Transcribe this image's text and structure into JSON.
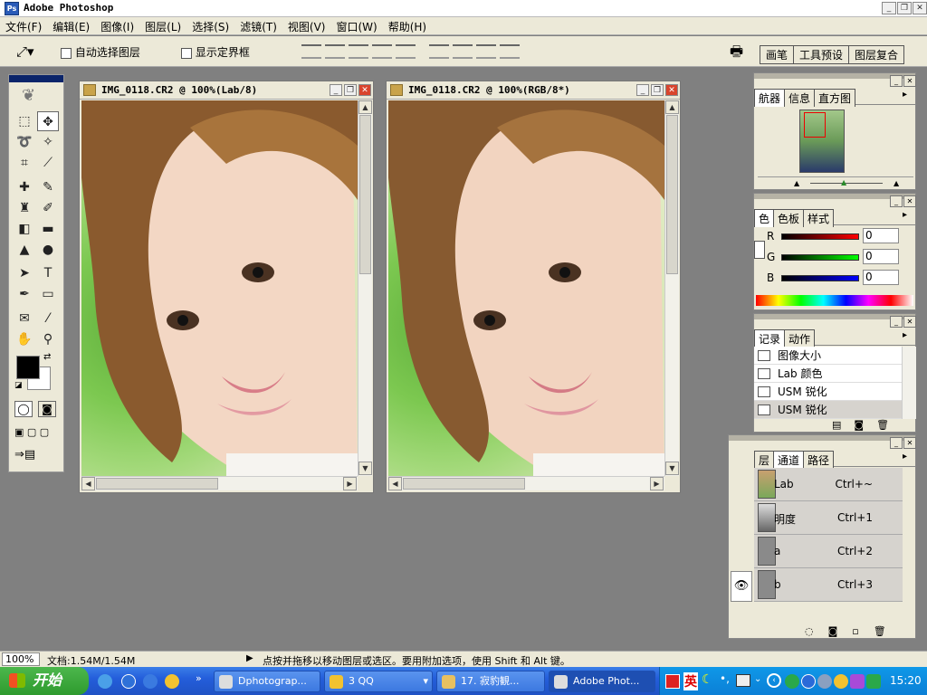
{
  "app": {
    "title": "Adobe Photoshop"
  },
  "menu": [
    "文件(F)",
    "编辑(E)",
    "图像(I)",
    "图层(L)",
    "选择(S)",
    "滤镜(T)",
    "视图(V)",
    "窗口(W)",
    "帮助(H)"
  ],
  "options": {
    "auto_select": "自动选择图层",
    "show_bounds": "显示定界框",
    "tabs": [
      "画笔",
      "工具预设",
      "图层复合"
    ]
  },
  "doc1": {
    "title": "IMG_0118.CR2 @ 100%(Lab/8)"
  },
  "doc2": {
    "title": "IMG_0118.CR2 @ 100%(RGB/8*)"
  },
  "navigator": {
    "tabs": [
      "航器",
      "信息",
      "直方图"
    ]
  },
  "color": {
    "tabs": [
      "色",
      "色板",
      "样式"
    ],
    "r_label": "R",
    "g_label": "G",
    "b_label": "B",
    "r_value": "0",
    "g_value": "0",
    "b_value": "0",
    "fg": "#000000",
    "bg": "#ffffff"
  },
  "history": {
    "tabs": [
      "记录",
      "动作"
    ],
    "items": [
      "图像大小",
      "Lab 颜色",
      "USM 锐化",
      "USM 锐化"
    ]
  },
  "channels": {
    "tabs": [
      "层",
      "通道",
      "路径"
    ],
    "rows": [
      {
        "name": "Lab",
        "shortcut": "Ctrl+~"
      },
      {
        "name": "明度",
        "shortcut": "Ctrl+1"
      },
      {
        "name": "a",
        "shortcut": "Ctrl+2"
      },
      {
        "name": "b",
        "shortcut": "Ctrl+3"
      }
    ]
  },
  "status": {
    "zoom": "100%",
    "doc_info": "文档:1.54M/1.54M",
    "hint": "点按并拖移以移动图层或选区。要用附加选项，使用 Shift 和 Alt 键。"
  },
  "taskbar": {
    "start": "开始",
    "items": [
      "Dphotograp...",
      "3 QQ",
      "17. 寂豹観...",
      "Adobe Phot..."
    ],
    "ime": "英",
    "clock": "15:20"
  }
}
